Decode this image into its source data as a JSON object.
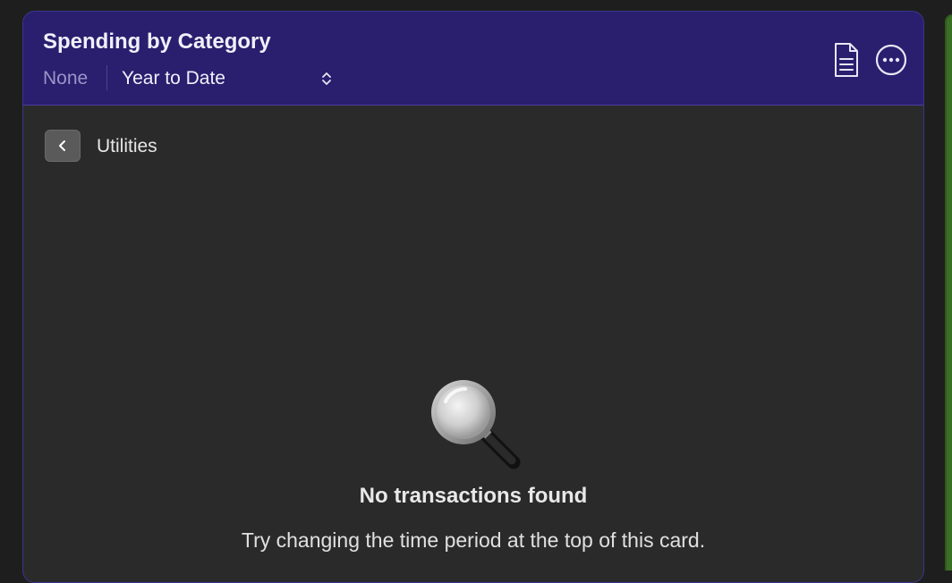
{
  "card": {
    "title": "Spending by Category",
    "filter_none": "None",
    "period": {
      "selected": "Year to Date"
    },
    "actions": {
      "report_icon": "document-icon",
      "more_icon": "ellipsis-circle-icon"
    }
  },
  "breadcrumb": {
    "back_icon": "chevron-left-icon",
    "category": "Utilities"
  },
  "empty_state": {
    "icon": "magnifying-glass-icon",
    "title": "No transactions found",
    "subtitle": "Try changing the time period at the top of this card."
  },
  "colors": {
    "header_bg": "#2a1e6e",
    "card_bg": "#2a2a2a",
    "page_bg": "#1e1e1e",
    "accent_border": "#3a3690"
  }
}
